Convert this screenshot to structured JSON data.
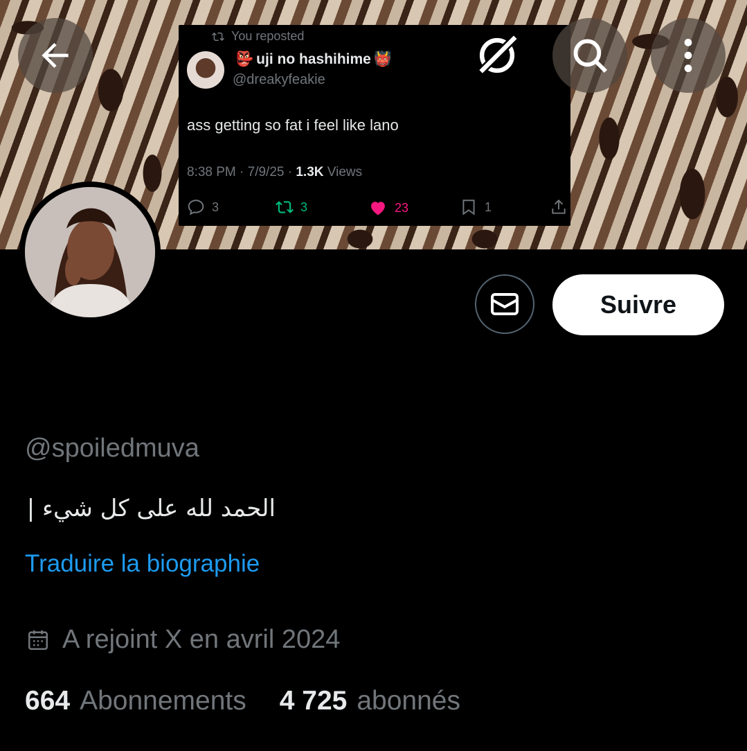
{
  "header": {
    "back_icon": "arrow-left-icon",
    "grok_icon": "grok-icon",
    "search_icon": "search-icon",
    "more_icon": "more-vertical-icon"
  },
  "pinned_tweet": {
    "reposted_label": "You reposted",
    "author_name": "uji no hashihime",
    "author_handle": "@dreakyfeakie",
    "text": "ass getting so fat i feel like lano",
    "timestamp": "8:38 PM · 7/9/25 · ",
    "views_count": "1.3K",
    "views_label": " Views",
    "replies": "3",
    "reposts": "3",
    "likes": "23",
    "bookmarks": "1"
  },
  "actions": {
    "follow_label": "Suivre"
  },
  "profile": {
    "handle": "@spoiledmuva",
    "bio": "الحمد لله على كل شيء |",
    "translate_label": "Traduire la biographie",
    "joined": "A rejoint X en avril 2024",
    "following_count": "664",
    "following_label": "Abonnements",
    "followers_count": "4 725",
    "followers_label": "abonnés"
  },
  "colors": {
    "accent": "#1d9bf0",
    "muted": "#71767b",
    "like": "#f91880",
    "repost": "#00ba7c"
  }
}
